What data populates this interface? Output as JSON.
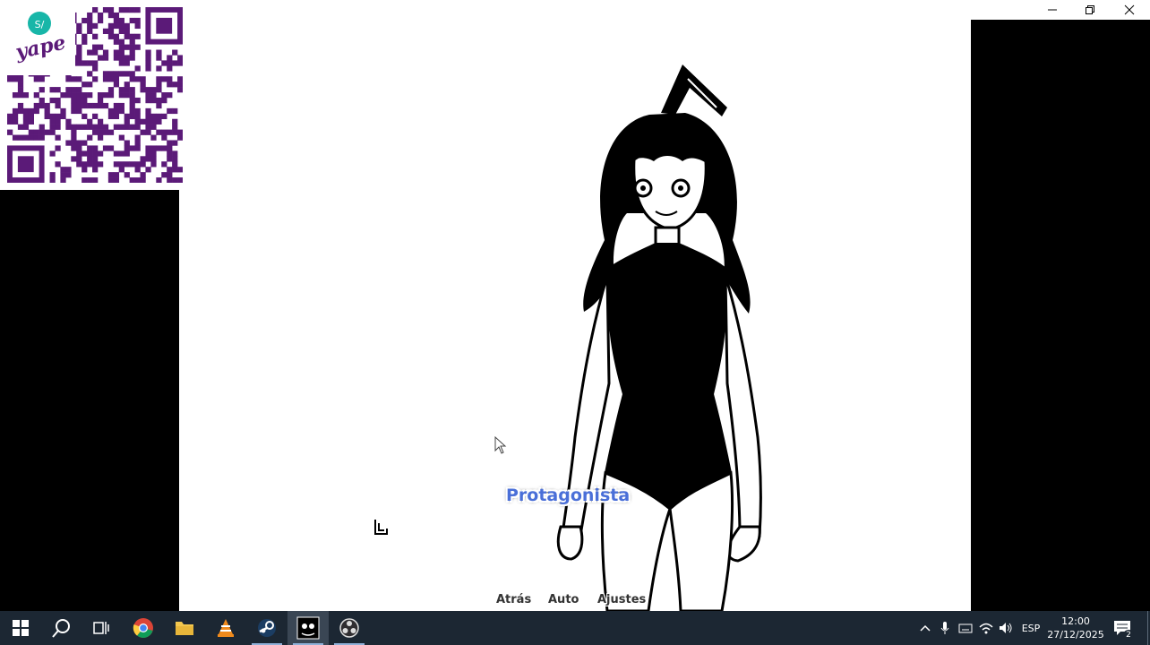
{
  "overlay": {
    "qr_brand": "yape",
    "qr_currency": "S/"
  },
  "game": {
    "speaker": "Protagonista",
    "quick_menu": [
      "Atrás",
      "Auto",
      "Ajustes"
    ]
  },
  "taskbar": {
    "apps": [
      "start-icon",
      "search-icon",
      "task-view-icon",
      "chrome-icon",
      "file-explorer-icon",
      "vlc-icon",
      "steam-icon",
      "game-app-icon",
      "obs-icon"
    ],
    "language": "ESP",
    "time": "12:00",
    "date": "27/12/2025",
    "notification_count": "2"
  },
  "colors": {
    "qr": "#5b1a78",
    "yape_badge": "#18b6a8",
    "speaker_name": "#4a6fd8",
    "taskbar": "#1c2733"
  }
}
